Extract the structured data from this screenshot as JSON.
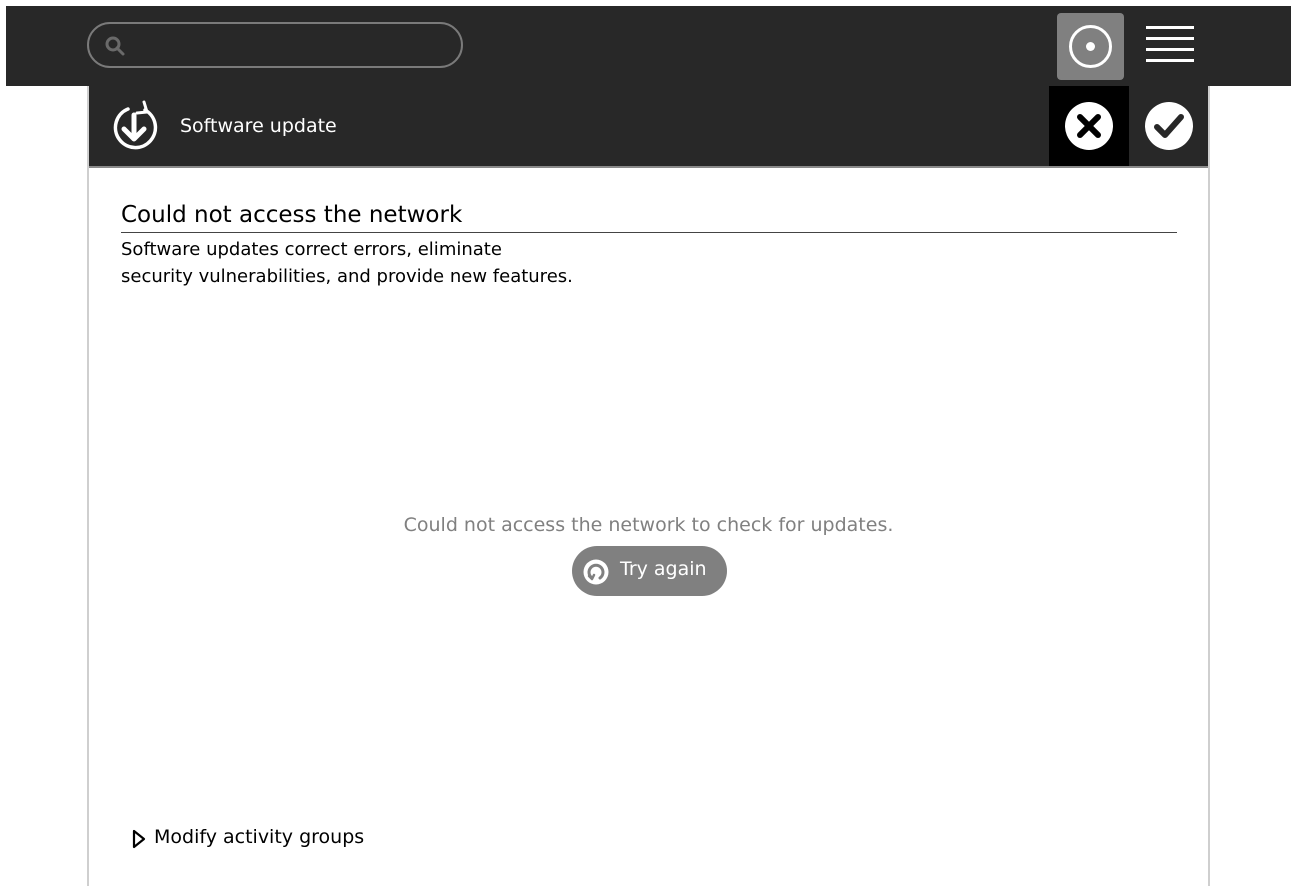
{
  "search": {
    "placeholder": "",
    "value": ""
  },
  "toolbar": {
    "title": "Software update"
  },
  "content": {
    "heading": "Could not access the network",
    "description_line1": "Software updates correct errors, eliminate",
    "description_line2": "security vulnerabilities, and provide new features.",
    "status_message": "Could not access the network to check for updates.",
    "retry_label": "Try again",
    "expander_label": "Modify activity groups"
  },
  "colors": {
    "toolbar_bg": "#282828",
    "cancel_bg": "#000000",
    "button_gray": "#808080",
    "status_text": "#808080"
  },
  "icons": {
    "search": "search-icon",
    "neighborhood": "neighborhood-icon",
    "menu": "menu-icon",
    "software_update": "software-update-icon",
    "cancel": "cancel-icon",
    "ok": "ok-icon",
    "retry": "retry-icon",
    "expander": "triangle-right-icon"
  }
}
